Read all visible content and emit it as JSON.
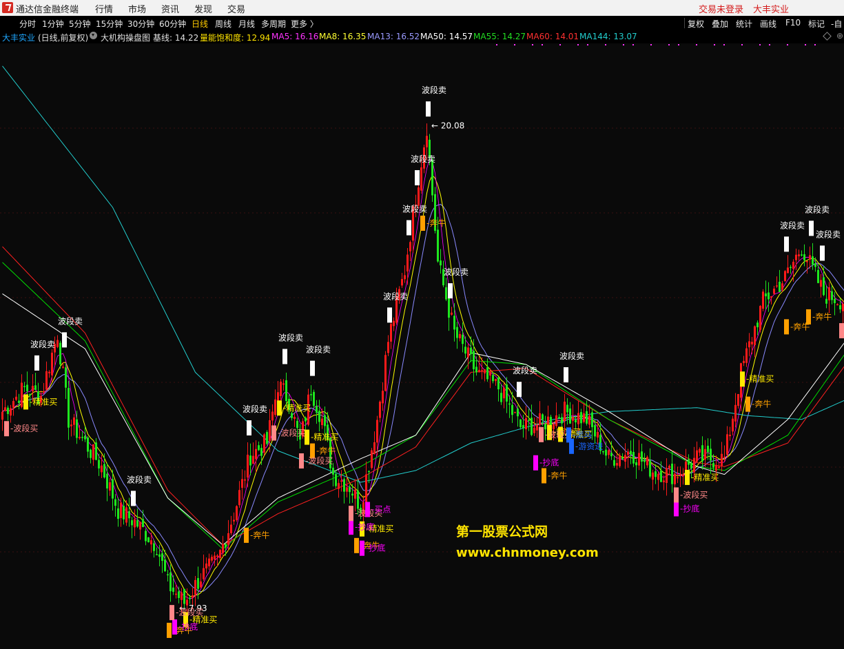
{
  "menubar": {
    "app_title": "通达信金融终端",
    "items": [
      "行情",
      "市场",
      "资讯",
      "发现",
      "交易"
    ],
    "status_login": "交易未登录",
    "status_stock": "大丰实业"
  },
  "toolbar": {
    "periods": [
      "分时",
      "1分钟",
      "5分钟",
      "15分钟",
      "30分钟",
      "60分钟",
      "日线",
      "周线",
      "月线",
      "多周期",
      "更多 〉"
    ],
    "active_period": "日线",
    "tools": [
      "复权",
      "叠加",
      "统计",
      "画线",
      "F10",
      "标记",
      "-自"
    ]
  },
  "infobar": {
    "stock": "大丰实业",
    "mode": "(日线,前复权)",
    "indicator_name": "大机构操盘图",
    "baseline": "基线: 14.22",
    "momentum": "量能饱和度: 12.94",
    "ma5": "MA5: 16.16",
    "ma8": "MA8: 16.35",
    "ma13": "MA13: 16.52",
    "ma50": "MA50: 14.57",
    "ma55": "MA55: 14.27",
    "ma60": "MA60: 14.01",
    "ma144": "MA144: 13.07"
  },
  "colors": {
    "up": "#ff1a1a",
    "down": "#1ee61e",
    "background": "#0a0a0a",
    "grid": "#3a1010",
    "ma5": "#ff00ff",
    "ma8": "#ffff00",
    "ma13": "#8a8aff",
    "ma50": "#ffffff",
    "ma55": "#00e000",
    "ma60": "#ff2020",
    "ma144": "#22cccc",
    "signal_sell": "#ffffff",
    "signal_buy": "#ffea00",
    "signal_bull": "#ffa000",
    "signal_bottom": "#ff00ff",
    "signal_wave_buy": "#ff8888",
    "signal_dark_horse": "#1a66ff"
  },
  "chart_data": {
    "type": "candlestick",
    "price_high_label": "20.08",
    "price_low_label": "7.93",
    "ylim": [
      7,
      22
    ],
    "ohlc_waypoints": [
      [
        0,
        12.8
      ],
      [
        8,
        13.4
      ],
      [
        14,
        13.2
      ],
      [
        20,
        14.8
      ],
      [
        24,
        12.6
      ],
      [
        30,
        12.0
      ],
      [
        36,
        11.4
      ],
      [
        42,
        10.3
      ],
      [
        48,
        10.0
      ],
      [
        56,
        9.4
      ],
      [
        60,
        8.4
      ],
      [
        66,
        7.93
      ],
      [
        72,
        8.6
      ],
      [
        78,
        9.0
      ],
      [
        84,
        10.2
      ],
      [
        90,
        11.7
      ],
      [
        96,
        12.0
      ],
      [
        100,
        13.5
      ],
      [
        104,
        13.1
      ],
      [
        108,
        12.0
      ],
      [
        112,
        13.4
      ],
      [
        116,
        12.6
      ],
      [
        120,
        11.2
      ],
      [
        126,
        10.9
      ],
      [
        130,
        10.4
      ],
      [
        136,
        12.6
      ],
      [
        140,
        14.6
      ],
      [
        146,
        16.4
      ],
      [
        150,
        18.3
      ],
      [
        154,
        20.08
      ],
      [
        158,
        16.6
      ],
      [
        164,
        14.8
      ],
      [
        172,
        13.8
      ],
      [
        180,
        13.4
      ],
      [
        188,
        12.4
      ],
      [
        196,
        12.5
      ],
      [
        204,
        12.8
      ],
      [
        212,
        12.6
      ],
      [
        220,
        11.6
      ],
      [
        228,
        11.8
      ],
      [
        236,
        11.3
      ],
      [
        244,
        11.2
      ],
      [
        252,
        11.6
      ],
      [
        262,
        11.6
      ],
      [
        268,
        13.8
      ],
      [
        276,
        15.6
      ],
      [
        284,
        16.2
      ],
      [
        290,
        17.0
      ],
      [
        298,
        15.8
      ],
      [
        306,
        15.6
      ]
    ],
    "ma_waypoints": {
      "ma50": [
        [
          0,
          15.8
        ],
        [
          30,
          14.4
        ],
        [
          60,
          10.6
        ],
        [
          80,
          9.4
        ],
        [
          100,
          10.6
        ],
        [
          130,
          11.6
        ],
        [
          150,
          12.2
        ],
        [
          170,
          14.3
        ],
        [
          190,
          14.0
        ],
        [
          220,
          12.8
        ],
        [
          252,
          11.4
        ],
        [
          262,
          11.2
        ],
        [
          285,
          12.6
        ],
        [
          306,
          14.6
        ]
      ],
      "ma55": [
        [
          0,
          16.6
        ],
        [
          30,
          14.6
        ],
        [
          60,
          10.6
        ],
        [
          80,
          9.3
        ],
        [
          100,
          10.5
        ],
        [
          130,
          11.4
        ],
        [
          150,
          12.2
        ],
        [
          170,
          14.1
        ],
        [
          190,
          14.0
        ],
        [
          220,
          12.6
        ],
        [
          252,
          11.4
        ],
        [
          262,
          11.3
        ],
        [
          285,
          12.2
        ],
        [
          306,
          14.3
        ]
      ],
      "ma60": [
        [
          0,
          17.0
        ],
        [
          30,
          14.8
        ],
        [
          60,
          10.8
        ],
        [
          80,
          9.4
        ],
        [
          100,
          10.2
        ],
        [
          130,
          11.1
        ],
        [
          150,
          11.9
        ],
        [
          170,
          13.8
        ],
        [
          190,
          13.9
        ],
        [
          220,
          12.6
        ],
        [
          252,
          11.5
        ],
        [
          262,
          11.4
        ],
        [
          285,
          12.0
        ],
        [
          306,
          14.0
        ]
      ],
      "ma144": [
        [
          0,
          21.6
        ],
        [
          40,
          18.0
        ],
        [
          70,
          13.8
        ],
        [
          100,
          11.8
        ],
        [
          130,
          11.0
        ],
        [
          150,
          11.3
        ],
        [
          170,
          12.0
        ],
        [
          200,
          12.6
        ],
        [
          220,
          12.8
        ],
        [
          252,
          12.9
        ],
        [
          270,
          12.7
        ],
        [
          290,
          12.6
        ],
        [
          306,
          13.1
        ]
      ]
    },
    "signals": [
      {
        "bar": 12,
        "label": "波段卖",
        "type": "sell"
      },
      {
        "bar": 22,
        "label": "波段卖",
        "type": "sell"
      },
      {
        "bar": 47,
        "label": "波段卖",
        "type": "sell"
      },
      {
        "bar": 89,
        "label": "波段卖",
        "type": "sell"
      },
      {
        "bar": 102,
        "label": "波段卖",
        "type": "sell"
      },
      {
        "bar": 112,
        "label": "波段卖",
        "type": "sell"
      },
      {
        "bar": 140,
        "label": "波段卖",
        "type": "sell"
      },
      {
        "bar": 147,
        "label": "波段卖",
        "type": "sell"
      },
      {
        "bar": 150,
        "label": "波段卖",
        "type": "sell"
      },
      {
        "bar": 154,
        "label": "波段卖",
        "type": "sell"
      },
      {
        "bar": 162,
        "label": "波段卖",
        "type": "sell"
      },
      {
        "bar": 187,
        "label": "波段卖",
        "type": "sell"
      },
      {
        "bar": 204,
        "label": "波段卖",
        "type": "sell"
      },
      {
        "bar": 284,
        "label": "波段卖",
        "type": "sell"
      },
      {
        "bar": 293,
        "label": "波段卖",
        "type": "sell"
      },
      {
        "bar": 297,
        "label": "波段卖",
        "type": "sell"
      },
      {
        "bar": 8,
        "label": "精准买",
        "type": "buy"
      },
      {
        "bar": 66,
        "label": "精准买",
        "type": "buy"
      },
      {
        "bar": 100,
        "label": "精准买",
        "type": "buy"
      },
      {
        "bar": 110,
        "label": "精准买",
        "type": "buy"
      },
      {
        "bar": 130,
        "label": "精准买",
        "type": "buy"
      },
      {
        "bar": 198,
        "label": "精准买",
        "type": "buy"
      },
      {
        "bar": 202,
        "label": "精准买",
        "type": "buy"
      },
      {
        "bar": 248,
        "label": "精准买",
        "type": "buy"
      },
      {
        "bar": 268,
        "label": "精准买",
        "type": "buy"
      },
      {
        "bar": 60,
        "label": "奔牛",
        "type": "bull"
      },
      {
        "bar": 88,
        "label": "奔牛",
        "type": "bull"
      },
      {
        "bar": 112,
        "label": "奔牛",
        "type": "bull"
      },
      {
        "bar": 128,
        "label": "奔牛",
        "type": "bull"
      },
      {
        "bar": 152,
        "label": "奔牛",
        "type": "bull"
      },
      {
        "bar": 196,
        "label": "奔牛",
        "type": "bull"
      },
      {
        "bar": 270,
        "label": "奔牛",
        "type": "bull"
      },
      {
        "bar": 284,
        "label": "奔牛",
        "type": "bull"
      },
      {
        "bar": 292,
        "label": "奔牛",
        "type": "bull"
      },
      {
        "bar": 62,
        "label": "抄底",
        "type": "bottom"
      },
      {
        "bar": 126,
        "label": "抄底",
        "type": "bottom"
      },
      {
        "bar": 130,
        "label": "抄底",
        "type": "bottom"
      },
      {
        "bar": 193,
        "label": "抄底",
        "type": "bottom"
      },
      {
        "bar": 244,
        "label": "抄底",
        "type": "bottom"
      },
      {
        "bar": 1,
        "label": "波段买",
        "type": "wave_buy"
      },
      {
        "bar": 61,
        "label": "波段买",
        "type": "wave_buy"
      },
      {
        "bar": 98,
        "label": "波段买",
        "type": "wave_buy"
      },
      {
        "bar": 108,
        "label": "波段买",
        "type": "wave_buy"
      },
      {
        "bar": 126,
        "label": "波段买",
        "type": "wave_buy"
      },
      {
        "bar": 195,
        "label": "波段买",
        "type": "wave_buy"
      },
      {
        "bar": 244,
        "label": "波段买",
        "type": "wave_buy"
      },
      {
        "bar": 304,
        "label": "波段买",
        "type": "wave_buy"
      },
      {
        "bar": 205,
        "label": "黑马",
        "type": "dark_horse"
      },
      {
        "bar": 206,
        "label": "游资进",
        "type": "dark_horse"
      },
      {
        "bar": 132,
        "label": "买点",
        "type": "bottom"
      }
    ]
  },
  "watermark": {
    "title": "第一股票公式网",
    "url": "www.chnmoney.com"
  }
}
